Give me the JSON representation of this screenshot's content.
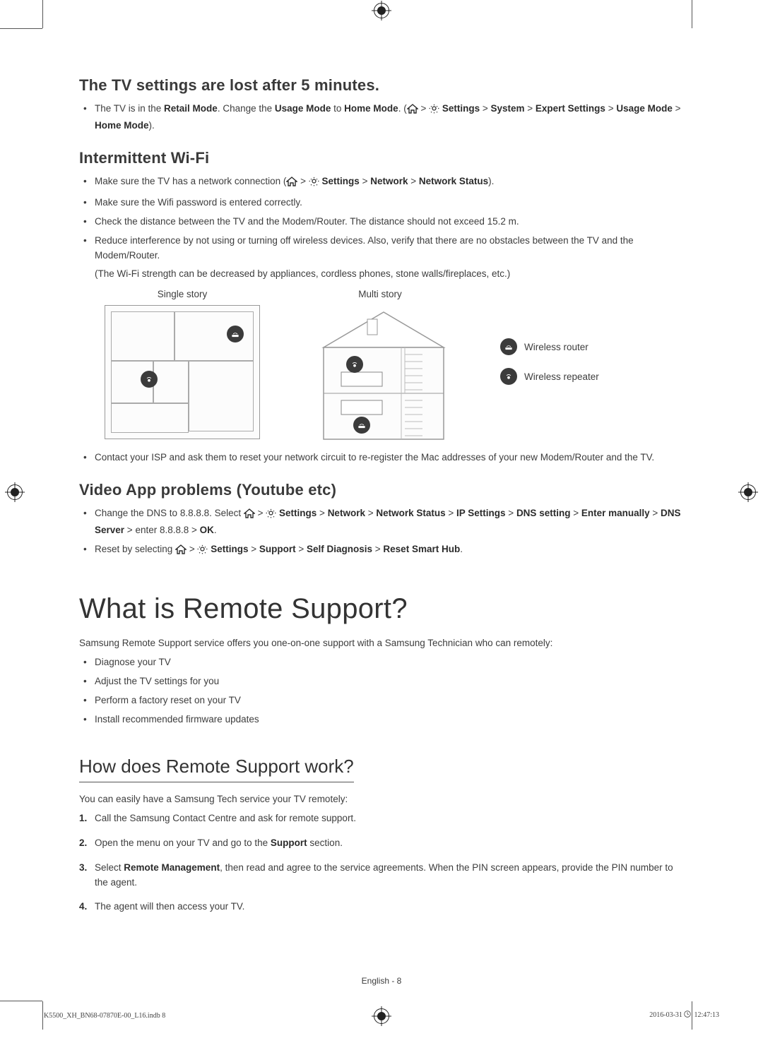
{
  "sections": {
    "tv_settings": {
      "heading": "The TV settings are lost after 5 minutes.",
      "item_prefix": "The TV is in the ",
      "retail_mode": "Retail Mode",
      "change_text": ". Change the ",
      "usage_mode": "Usage Mode",
      "to_text": " to ",
      "home_mode": "Home Mode",
      "period_open": ". (",
      "path1": " Settings",
      "path2": "System",
      "path3": "Expert Settings",
      "path4": "Usage Mode",
      "path5": "Home Mode",
      "close": ")."
    },
    "wifi": {
      "heading": "Intermittent Wi-Fi",
      "b1_prefix": "Make sure the TV has a network connection (",
      "b1_settings": " Settings",
      "b1_network": "Network",
      "b1_status": "Network Status",
      "b1_close": ").",
      "b2": "Make sure the Wifi password is entered correctly.",
      "b3": "Check the distance between the TV and the Modem/Router. The distance should not exceed 15.2 m.",
      "b4": "Reduce interference by not using or turning off wireless devices. Also, verify that there are no obstacles between the TV and the Modem/Router.",
      "b4_note": "(The Wi-Fi strength can be decreased by appliances, cordless phones, stone walls/fireplaces, etc.)",
      "single_story": "Single story",
      "multi_story": "Multi story",
      "wireless_router": "Wireless router",
      "wireless_repeater": "Wireless repeater",
      "b5": "Contact your ISP and ask them to reset your network circuit to re-register the Mac addresses of your new Modem/Router and the TV."
    },
    "video": {
      "heading": "Video App problems (Youtube etc)",
      "b1_prefix": "Change the DNS to 8.8.8.8. Select ",
      "b1_settings": " Settings",
      "b1_network": "Network",
      "b1_status": "Network Status",
      "b1_ip": "IP Settings",
      "b1_dns": "DNS setting",
      "b1_enter": "Enter manually",
      "b1_server": "DNS Server",
      "b1_val": " enter 8.8.8.8 ",
      "b1_ok": "OK",
      "b2_prefix": "Reset by selecting ",
      "b2_settings": " Settings",
      "b2_support": "Support",
      "b2_self": "Self Diagnosis",
      "b2_reset": "Reset Smart Hub"
    },
    "remote_support": {
      "heading": "What is Remote Support?",
      "lead": "Samsung Remote Support service offers you one-on-one support with a Samsung Technician who can remotely:",
      "b1": "Diagnose your TV",
      "b2": "Adjust the TV settings for you",
      "b3": "Perform a factory reset on your TV",
      "b4": "Install recommended firmware updates"
    },
    "how_works": {
      "heading": "How does Remote Support work?",
      "lead": "You can easily have a Samsung Tech service your TV remotely:",
      "s1": "Call the Samsung Contact Centre and ask for remote support.",
      "s2_a": "Open the menu on your TV and go to the ",
      "s2_b": "Support",
      "s2_c": " section.",
      "s3_a": "Select ",
      "s3_b": "Remote Management",
      "s3_c": ", then read and agree to the service agreements. When the PIN screen appears, provide the PIN number to the agent.",
      "s4": "The agent will then access your TV."
    }
  },
  "footer": {
    "center": "English - 8",
    "left": "K5500_XH_BN68-07870E-00_L16.indb   8",
    "right_date": "2016-03-31   ",
    "right_time": "12:47:13"
  },
  "glyphs": {
    "chevron": " > "
  }
}
